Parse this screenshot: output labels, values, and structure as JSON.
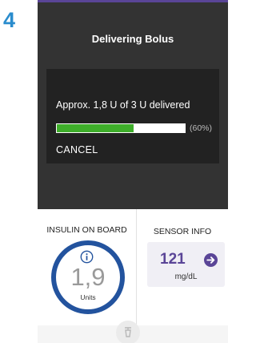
{
  "step": {
    "number": "4"
  },
  "overlay": {
    "title": "Delivering Bolus"
  },
  "dialog": {
    "message": "Approx. 1,8 U of 3 U delivered",
    "progress_fraction": 0.6,
    "progress_label": "(60%)",
    "cancel_label": "CANCEL"
  },
  "insulin_on_board": {
    "title": "INSULIN ON BOARD",
    "value": "1,9",
    "unit": "Units",
    "icon": "info-icon"
  },
  "sensor_info": {
    "title": "SENSOR INFO",
    "value": "121",
    "unit": "mg/dL",
    "icon": "arrow-right-circle-icon"
  },
  "colors": {
    "accent": "#5a4597",
    "ring": "#23539e",
    "progress": "#3eae2a",
    "overlay": "#333333",
    "dialog": "#222222",
    "step_number": "#2a8ccd"
  }
}
